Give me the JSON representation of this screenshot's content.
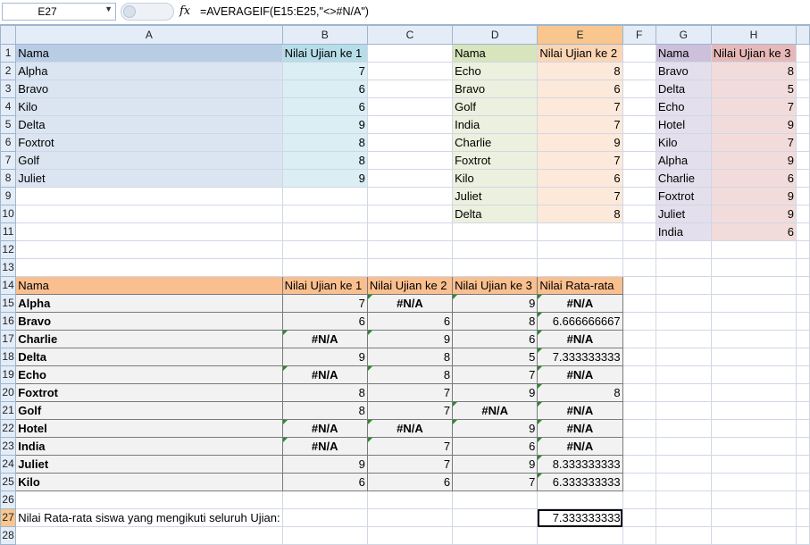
{
  "formula_bar": {
    "cell_ref": "E27",
    "fx_label": "fx",
    "formula": "=AVERAGEIF(E15:E25,\"<>#N/A\")"
  },
  "columns": [
    "A",
    "B",
    "C",
    "D",
    "E",
    "F",
    "G",
    "H"
  ],
  "selected_column": "E",
  "selected_row": 27,
  "table1": {
    "header": [
      "Nama",
      "Nilai Ujian ke 1"
    ],
    "rows": [
      [
        "Alpha",
        "7"
      ],
      [
        "Bravo",
        "6"
      ],
      [
        "Kilo",
        "6"
      ],
      [
        "Delta",
        "9"
      ],
      [
        "Foxtrot",
        "8"
      ],
      [
        "Golf",
        "8"
      ],
      [
        "Juliet",
        "9"
      ]
    ]
  },
  "table2": {
    "header": [
      "Nama",
      "Nilai Ujian ke 2"
    ],
    "rows": [
      [
        "Echo",
        "8"
      ],
      [
        "Bravo",
        "6"
      ],
      [
        "Golf",
        "7"
      ],
      [
        "India",
        "7"
      ],
      [
        "Charlie",
        "9"
      ],
      [
        "Foxtrot",
        "7"
      ],
      [
        "Kilo",
        "6"
      ],
      [
        "Juliet",
        "7"
      ],
      [
        "Delta",
        "8"
      ]
    ]
  },
  "table3": {
    "header": [
      "Nama",
      "Nilai Ujian ke 3"
    ],
    "rows": [
      [
        "Bravo",
        "8"
      ],
      [
        "Delta",
        "5"
      ],
      [
        "Echo",
        "7"
      ],
      [
        "Hotel",
        "9"
      ],
      [
        "Kilo",
        "7"
      ],
      [
        "Alpha",
        "9"
      ],
      [
        "Charlie",
        "6"
      ],
      [
        "Foxtrot",
        "9"
      ],
      [
        "Juliet",
        "9"
      ],
      [
        "India",
        "6"
      ]
    ]
  },
  "summary": {
    "header": [
      "Nama",
      "Nilai Ujian ke 1",
      "Nilai Ujian ke 2",
      "Nilai Ujian ke 3",
      "Nilai Rata-rata"
    ],
    "rows": [
      [
        "Alpha",
        "7",
        "#N/A",
        "9",
        "#N/A"
      ],
      [
        "Bravo",
        "6",
        "6",
        "8",
        "6.666666667"
      ],
      [
        "Charlie",
        "#N/A",
        "9",
        "6",
        "#N/A"
      ],
      [
        "Delta",
        "9",
        "8",
        "5",
        "7.333333333"
      ],
      [
        "Echo",
        "#N/A",
        "8",
        "7",
        "#N/A"
      ],
      [
        "Foxtrot",
        "8",
        "7",
        "9",
        "8"
      ],
      [
        "Golf",
        "8",
        "7",
        "#N/A",
        "#N/A"
      ],
      [
        "Hotel",
        "#N/A",
        "#N/A",
        "9",
        "#N/A"
      ],
      [
        "India",
        "#N/A",
        "7",
        "6",
        "#N/A"
      ],
      [
        "Juliet",
        "9",
        "7",
        "9",
        "8.333333333"
      ],
      [
        "Kilo",
        "6",
        "6",
        "7",
        "6.333333333"
      ]
    ]
  },
  "result": {
    "label": "Nilai Rata-rata siswa yang mengikuti seluruh Ujian:",
    "value": "7.333333333"
  },
  "colors": {
    "selected_header": "#f8c68e",
    "header_bg": "#e4ecf7",
    "summary_header": "#fabf8f",
    "error_triangle": "#2a8a2a"
  }
}
